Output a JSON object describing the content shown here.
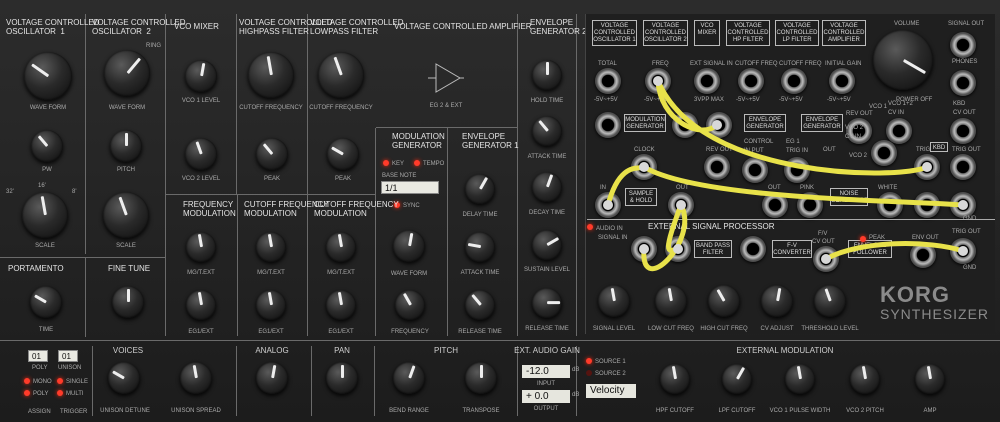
{
  "vco": {
    "vco1_title": "VOLTAGE CONTROLLED\nOSCILLATOR  1",
    "vco2_title": "VOLTAGE CONTROLLED\nOSCILLATOR  2",
    "ring": "RING",
    "waveform": "WAVE FORM",
    "pw": "PW",
    "pitch": "PITCH",
    "scale": "SCALE",
    "scale_32": "32'",
    "scale_16": "16'",
    "scale_8": "8'"
  },
  "vco_mixer": {
    "title": "VCO MIXER",
    "vco1_level": "VCO 1 LEVEL",
    "vco2_level": "VCO 2 LEVEL"
  },
  "hpf": {
    "title": "VOLTAGE CONTROLLED\nHIGHPASS FILTER",
    "cutoff": "CUTOFF FREQUENCY",
    "peak": "PEAK"
  },
  "lpf": {
    "title": "VOLTAGE CONTROLLED\nLOWPASS FILTER",
    "cutoff": "CUTOFF FREQUENCY",
    "peak": "PEAK"
  },
  "vca": {
    "title": "VOLTAGE CONTROLLED AMPLIFIER",
    "eg": "EG 2 & EXT"
  },
  "eg2": {
    "title": "ENVELOPE\nGENERATOR 2",
    "hold": "HOLD TIME",
    "attack": "ATTACK TIME",
    "decay": "DECAY TIME",
    "sustain": "SUSTAIN LEVEL",
    "release": "RELEASE TIME"
  },
  "eg1": {
    "title": "ENVELOPE\nGENERATOR 1",
    "delay": "DELAY TIME",
    "attack": "ATTACK TIME",
    "release": "RELEASE TIME"
  },
  "modgen": {
    "title": "MODULATION\nGENERATOR",
    "base_note": "BASE NOTE",
    "base_value": "1/1",
    "key": "KEY",
    "tempo": "TEMPO",
    "sync": "SYNC",
    "waveform": "WAVE FORM",
    "frequency": "FREQUENCY"
  },
  "freqmod": {
    "title": "FREQUENCY\nMODULATION",
    "mg": "MG/T.EXT",
    "eg": "EG1/EXT"
  },
  "cutmod1": {
    "title": "CUTOFF FREQUENCY\nMODULATION",
    "mg": "MG/T.EXT",
    "eg": "EG1/EXT"
  },
  "cutmod2": {
    "title": "CUTOFF FREQUENCY\nMODULATION",
    "mg": "MG/T.EXT",
    "eg": "EG1/EXT"
  },
  "portamento": {
    "title": "PORTAMENTO",
    "time": "TIME"
  },
  "finetune": {
    "title": "FINE TUNE"
  },
  "patch": {
    "top_boxes": [
      "VOLTAGE\nCONTROLLED\nOSCILLATOR 1",
      "VOLTAGE\nCONTROLLED\nOSCILLATOR 2",
      "VCO\nMIXER",
      "VOLTAGE\nCONTROLLED\nHP FILTER",
      "VOLTAGE\nCONTROLLED\nLP FILTER",
      "VOLTAGE\nCONTROLLED\nAMPLIFIER"
    ],
    "jack_labels": [
      "TOTAL",
      "FREQ",
      "EXT SIGNAL IN",
      "CUTOFF FREQ",
      "CUTOFF FREQ",
      "INITIAL GAIN"
    ],
    "volts": [
      "-5V~+5V",
      "-5V~+5V",
      "3VPP MAX",
      "-5V~+5V",
      "-5V~+5V",
      "-5V~+5V"
    ],
    "volume": "VOLUME",
    "power": "POWER OFF",
    "signal_out": "SIGNAL OUT",
    "phones": "PHONES",
    "vco1": "VCO 1",
    "vco12": "VCO 1+2\nCV IN",
    "vco2": "VCO 2",
    "kbd_cv": "KBD\nCV OUT",
    "mod_gen": "MODULATION\nGENERATOR",
    "env_gen": "ENVELOPE\nGENERATOR",
    "env_gen2": "ENVELOPE\nGENERATOR",
    "rev_out": "REV OUT",
    "rev_out2": "REV OUT",
    "control_in": "CONTROL\nIN PUT",
    "eg1": "EG 1\nTRIG IN",
    "out": "OUT",
    "vco2cv": "VCO 2\nCV IN",
    "trig_in": "TRIG IN",
    "kbd": "KBD",
    "trig_out": "TRIG OUT",
    "clock": "CLOCK",
    "in": "IN",
    "sample_hold": "SAMPLE\n& HOLD",
    "pink": "PINK",
    "noise": "NOISE\nGENERATOR",
    "white": "WHITE",
    "gnd": "GND",
    "esp_title": "EXTERNAL SIGNAL PROCESSOR",
    "audio_in": "AUDIO IN",
    "signal_in": "SIGNAL IN",
    "bpf": "BAND PASS\nFILTER",
    "fv": "F-V\nCONVERTER",
    "fv_label": "F/V",
    "cv_out": "CV OUT",
    "env_follower": "ENVELOPE\nFOLLOWER",
    "env_out": "ENV OUT",
    "esp_trig": "TRIG OUT",
    "peak": "PEAK",
    "signal_level": "SIGNAL LEVEL",
    "low_cut": "LOW CUT FREQ",
    "high_cut": "HIGH CUT FREQ",
    "cv_adjust": "CV ADJUST",
    "threshold": "THRESHOLD LEVEL"
  },
  "logo": {
    "brand": "KORG",
    "product": "SYNTHESIZER"
  },
  "bottom": {
    "poly_value": "01",
    "poly": "POLY",
    "unison_value": "01",
    "unison": "UNISON",
    "voices": "VOICES",
    "mono": "MONO",
    "poly_opt": "POLY",
    "single": "SINGLE",
    "multi": "MULTI",
    "assign": "ASSIGN",
    "trigger": "TRIGGER",
    "unison_detune": "UNISON DETUNE",
    "analog": "ANALOG",
    "unison_spread": "UNISON SPREAD",
    "pan": "PAN",
    "pitch": "PITCH",
    "bend_range": "BEND RANGE",
    "transpose": "TRANSPOSE",
    "ext_audio_gain": "EXT. AUDIO GAIN",
    "input_value": "-12.0",
    "input": "INPUT",
    "output_value": "+ 0.0",
    "output": "OUTPUT",
    "db": "dB",
    "source1": "SOURCE 1",
    "source2": "SOURCE 2",
    "source_value": "Velocity",
    "ext_mod": "EXTERNAL MODULATION",
    "hpf_cutoff": "HPF CUTOFF",
    "lpf_cutoff": "LPF CUTOFF",
    "vco1_pw": "VCO 1 PULSE WIDTH",
    "vco2_pitch": "VCO 2 PITCH",
    "amp": "AMP"
  },
  "colors": {
    "cable": "#e8e24a",
    "led_on": "#ff3b2a",
    "panel": "#262626"
  }
}
